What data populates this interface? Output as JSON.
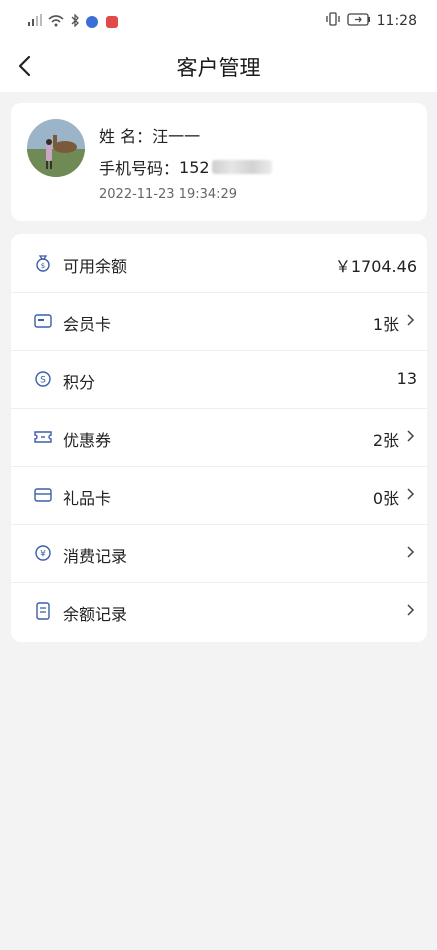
{
  "status_bar": {
    "time": "11:28"
  },
  "header": {
    "title": "客户管理"
  },
  "profile": {
    "name_label": "姓  名：",
    "name": "汪一一",
    "phone_label": "手机号码：",
    "phone_visible": "152",
    "date": "2022-11-23 19:34:29"
  },
  "menu": {
    "items": [
      {
        "label": "可用余额",
        "value": "￥1704.46",
        "icon": "money-bag-icon",
        "chevron": false
      },
      {
        "label": "会员卡",
        "value": "1张",
        "icon": "member-card-icon",
        "chevron": true
      },
      {
        "label": "积分",
        "value": "13",
        "icon": "points-icon",
        "chevron": false
      },
      {
        "label": "优惠券",
        "value": "2张",
        "icon": "coupon-icon",
        "chevron": true
      },
      {
        "label": "礼品卡",
        "value": "0张",
        "icon": "gift-card-icon",
        "chevron": true
      },
      {
        "label": "消费记录",
        "value": "",
        "icon": "consumption-record-icon",
        "chevron": true
      },
      {
        "label": "余额记录",
        "value": "",
        "icon": "balance-record-icon",
        "chevron": true
      }
    ]
  },
  "colors": {
    "background": "#f3f3f3",
    "card": "#ffffff",
    "icon_accent": "#3b5ea8"
  }
}
